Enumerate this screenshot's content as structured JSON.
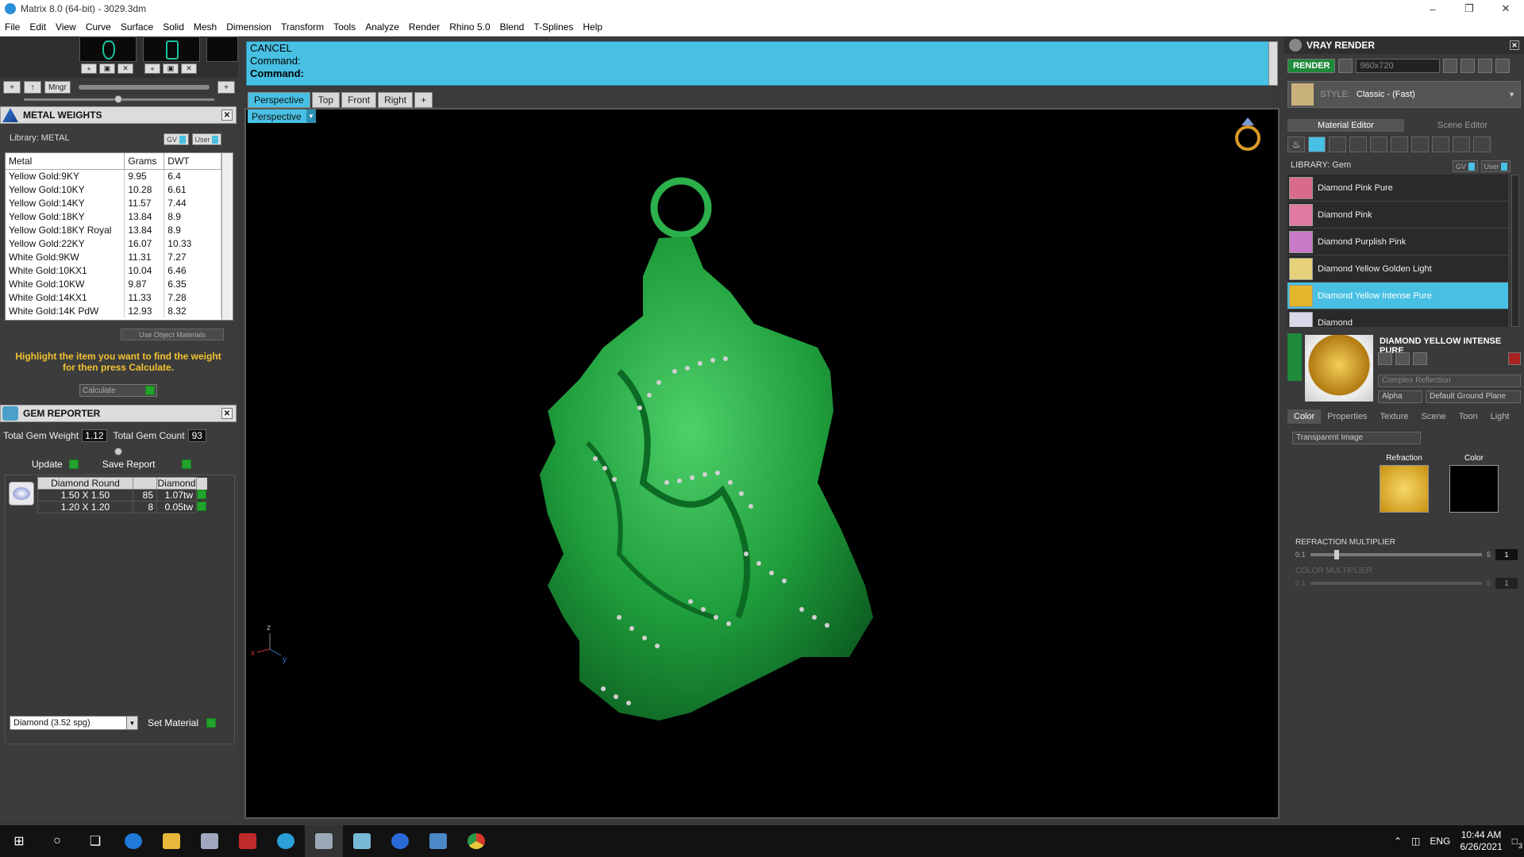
{
  "window": {
    "title": "Matrix 8.0 (64-bit) - 3029.3dm"
  },
  "menu": [
    "File",
    "Edit",
    "View",
    "Curve",
    "Surface",
    "Solid",
    "Mesh",
    "Dimension",
    "Transform",
    "Tools",
    "Analyze",
    "Render",
    "Rhino 5.0",
    "Blend",
    "T-Splines",
    "Help"
  ],
  "toolbar": {
    "mngr_label": "Mngr"
  },
  "command": {
    "line1": "CANCEL",
    "line2": "Command:",
    "line3": "Command:"
  },
  "viewtabs": [
    "Perspective",
    "Top",
    "Front",
    "Right",
    "+"
  ],
  "viewport": {
    "label": "Perspective",
    "axis_x": "x",
    "axis_y": "y",
    "axis_z": "z"
  },
  "metal_weights": {
    "title": "METAL WEIGHTS",
    "library": "Library: METAL",
    "gv_label": "GV",
    "user_label": "User",
    "columns": [
      "Metal",
      "Grams",
      "DWT"
    ],
    "rows": [
      [
        "Yellow Gold:9KY",
        "9.95",
        "6.4"
      ],
      [
        "Yellow Gold:10KY",
        "10.28",
        "6.61"
      ],
      [
        "Yellow Gold:14KY",
        "11.57",
        "7.44"
      ],
      [
        "Yellow Gold:18KY",
        "13.84",
        "8.9"
      ],
      [
        "Yellow Gold:18KY Royal",
        "13.84",
        "8.9"
      ],
      [
        "Yellow Gold:22KY",
        "16.07",
        "10.33"
      ],
      [
        "White Gold:9KW",
        "11.31",
        "7.27"
      ],
      [
        "White Gold:10KX1",
        "10.04",
        "6.46"
      ],
      [
        "White Gold:10KW",
        "9.87",
        "6.35"
      ],
      [
        "White Gold:14KX1",
        "11.33",
        "7.28"
      ],
      [
        "White Gold:14K PdW",
        "12.93",
        "8.32"
      ]
    ],
    "use_object_materials": "Use Object Materials",
    "hint": "Highlight the item you want to find the weight for then press Calculate.",
    "calculate": "Calculate"
  },
  "gem_reporter": {
    "title": "GEM REPORTER",
    "total_weight_label": "Total Gem Weight",
    "total_weight": "1.12",
    "total_count_label": "Total Gem Count",
    "total_count": "93",
    "update": "Update",
    "save_report": "Save Report",
    "columns": [
      "Diamond Round",
      "",
      "Diamond"
    ],
    "rows": [
      [
        "1.50 X 1.50",
        "85",
        "1.07tw"
      ],
      [
        "1.20 X 1.20",
        "8",
        "0.05tw"
      ]
    ],
    "material_select": "Diamond     (3.52 spg)",
    "set_material": "Set Material"
  },
  "vray": {
    "title": "VRAY RENDER",
    "render_label": "RENDER",
    "resolution": "960x720",
    "style_label": "STYLE:",
    "style_value": "Classic - (Fast)",
    "tab_material_editor": "Material Editor",
    "tab_scene_editor": "Scene Editor",
    "library": "LIBRARY: Gem",
    "gv_label": "GV",
    "user_label": "User",
    "materials": [
      {
        "name": "Diamond Pink Pure",
        "color": "#d86a8a"
      },
      {
        "name": "Diamond Pink",
        "color": "#e07aa0"
      },
      {
        "name": "Diamond Purplish Pink",
        "color": "#c87ac8"
      },
      {
        "name": "Diamond Yellow Golden Light",
        "color": "#e6d27a"
      },
      {
        "name": "Diamond Yellow Intense Pure",
        "color": "#e3b52a"
      },
      {
        "name": "Diamond",
        "color": "#d8d8e8"
      }
    ],
    "selected_material": "DIAMOND YELLOW INTENSE PURE",
    "reflection_mode": "Complex Reflection",
    "alpha_label": "Alpha",
    "ground_plane": "Default Ground Plane",
    "prop_tabs": [
      "Color",
      "Properties",
      "Texture",
      "Scene",
      "Toon",
      "Light"
    ],
    "transparent_image": "Transparent Image",
    "refraction_label": "Refraction",
    "color_label": "Color",
    "refraction_multiplier_label": "REFRACTION MULTIPLIER",
    "refraction_min": "0.1",
    "refraction_max": "5",
    "refraction_value": "1",
    "color_multiplier_label": "COLOR MULTIPLIER",
    "color_min": "0.1",
    "color_max": "5",
    "color_value": "1"
  },
  "taskbar": {
    "time": "10:44 AM",
    "date": "6/26/2021",
    "lang": "ENG",
    "notifications": "3"
  },
  "colors": {
    "accent": "#48c0e3",
    "model_green": "#1f9e3c"
  }
}
